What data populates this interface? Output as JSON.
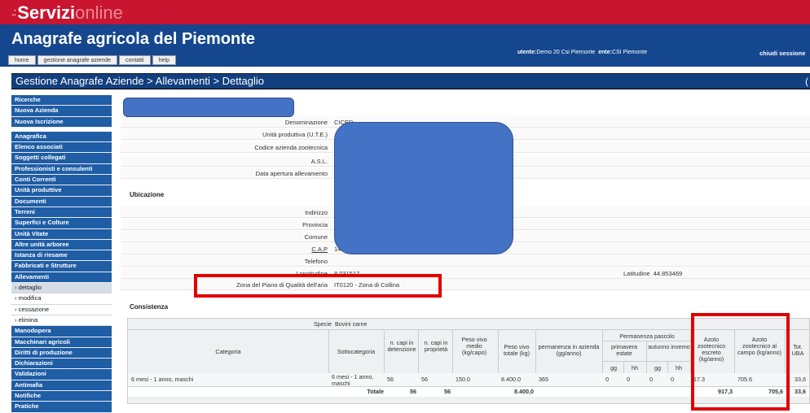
{
  "brand": {
    "dots": ".:",
    "bold": "Servizi",
    "light": "online"
  },
  "app": {
    "title": "Anagrafe agricola del Piemonte"
  },
  "nav": {
    "tabs": [
      "home",
      "gestione anagrafe aziende",
      "contatti",
      "help"
    ]
  },
  "user": {
    "utente_label": "utente:",
    "utente_value": "Demo 20 Csi Piemonte",
    "ente_label": "ente:",
    "ente_value": "CSI Piemonte",
    "close": "chiudi sessione"
  },
  "breadcrumb": {
    "text": "Gestione Anagrafe Aziende > Allevamenti > Dettaglio",
    "right": "("
  },
  "sidebar": {
    "group1": [
      "Ricerche",
      "Nuova Azienda",
      "Nuova Iscrizione"
    ],
    "group2": [
      "Anagrafica",
      "Elenco associati",
      "Soggetti collegati",
      "Professionisti e consulenti",
      "Conti Correnti",
      "Unità produttive",
      "Documenti",
      "Terreni",
      "Superfici e Colture",
      "Unità Vitate",
      "Altre unità arboree",
      "Istanza di riesame",
      "Fabbricati e Strutture",
      "Allevamenti"
    ],
    "sub": [
      "› dettaglio",
      "› modifica",
      "› cessazione",
      "› elimina"
    ],
    "group3": [
      "Manodopera",
      "Macchinari agricoli",
      "Diritti di produzione",
      "Dichiarazioni",
      "Validazioni",
      "Antimafia",
      "Notifiche",
      "Pratiche"
    ]
  },
  "detail": {
    "denominazione_label": "Denominazione",
    "denominazione_value": "CICER",
    "ute_label": "Unità produttiva (U.T.E.)",
    "codice_label": "Codice azienda zootecnica",
    "asl_label": "A.S.L.",
    "apertura_label": "Data apertura allevamento"
  },
  "ubicazione": {
    "title": "Ubicazione",
    "indirizzo_label": "Indirizzo",
    "provincia_label": "Provincia",
    "comune_label": "Comune",
    "cap_label": "C.A.P",
    "cap_value": "14",
    "telefono_label": "Telefono",
    "longitudine_label": "Longitudine",
    "longitudine_value": "8.031517",
    "latitudine_label": "Latitudine",
    "latitudine_value": "44.853469",
    "zona_label": "Zona del Piano di Qualità dell'aria",
    "zona_value": "IT0120 - Zona di Collina"
  },
  "consistenza": {
    "title": "Consistenza",
    "specie_label": "Specie",
    "specie_value": "Bovini carne",
    "headers": {
      "categoria": "Categoria",
      "sottocategoria": "Sottocategoria",
      "capi_detenzione": "n. capi in detenzione",
      "capi_proprieta": "n. capi in proprietà",
      "peso_medio": "Peso vivo medio (kg/capo)",
      "peso_totale": "Peso vivo totale (kg)",
      "permanenza": "permanenza in azienda (gg/anno)",
      "pascolo": "Permanenza pascolo",
      "primavera": "primavera estate",
      "autunno": "autunno inverno",
      "gg": "gg",
      "hh": "hh",
      "azoto_escreto": "Azoto zootecnico escreto (kg/anno)",
      "azoto_campo": "Azoto zootecnico al campo (kg/anno)",
      "uba": "Tot. UBA"
    },
    "row": {
      "categoria": "6 mesi - 1 anno, maschi",
      "sottocategoria": "6 mesi - 1 anno, maschi",
      "detenzione": "56",
      "proprieta": "56",
      "peso_medio": "150.0",
      "peso_totale": "8.400.0",
      "permanenza": "365",
      "gg1": "0",
      "hh1": "0",
      "gg2": "0",
      "hh2": "0",
      "escreto": "17.3",
      "campo": "705.6",
      "uba": "33,6"
    },
    "totale": {
      "label": "Totale",
      "detenzione": "56",
      "proprieta": "56",
      "peso_totale": "8.400,0",
      "escreto": "917,3",
      "campo": "705,6",
      "uba": "33,6"
    }
  }
}
